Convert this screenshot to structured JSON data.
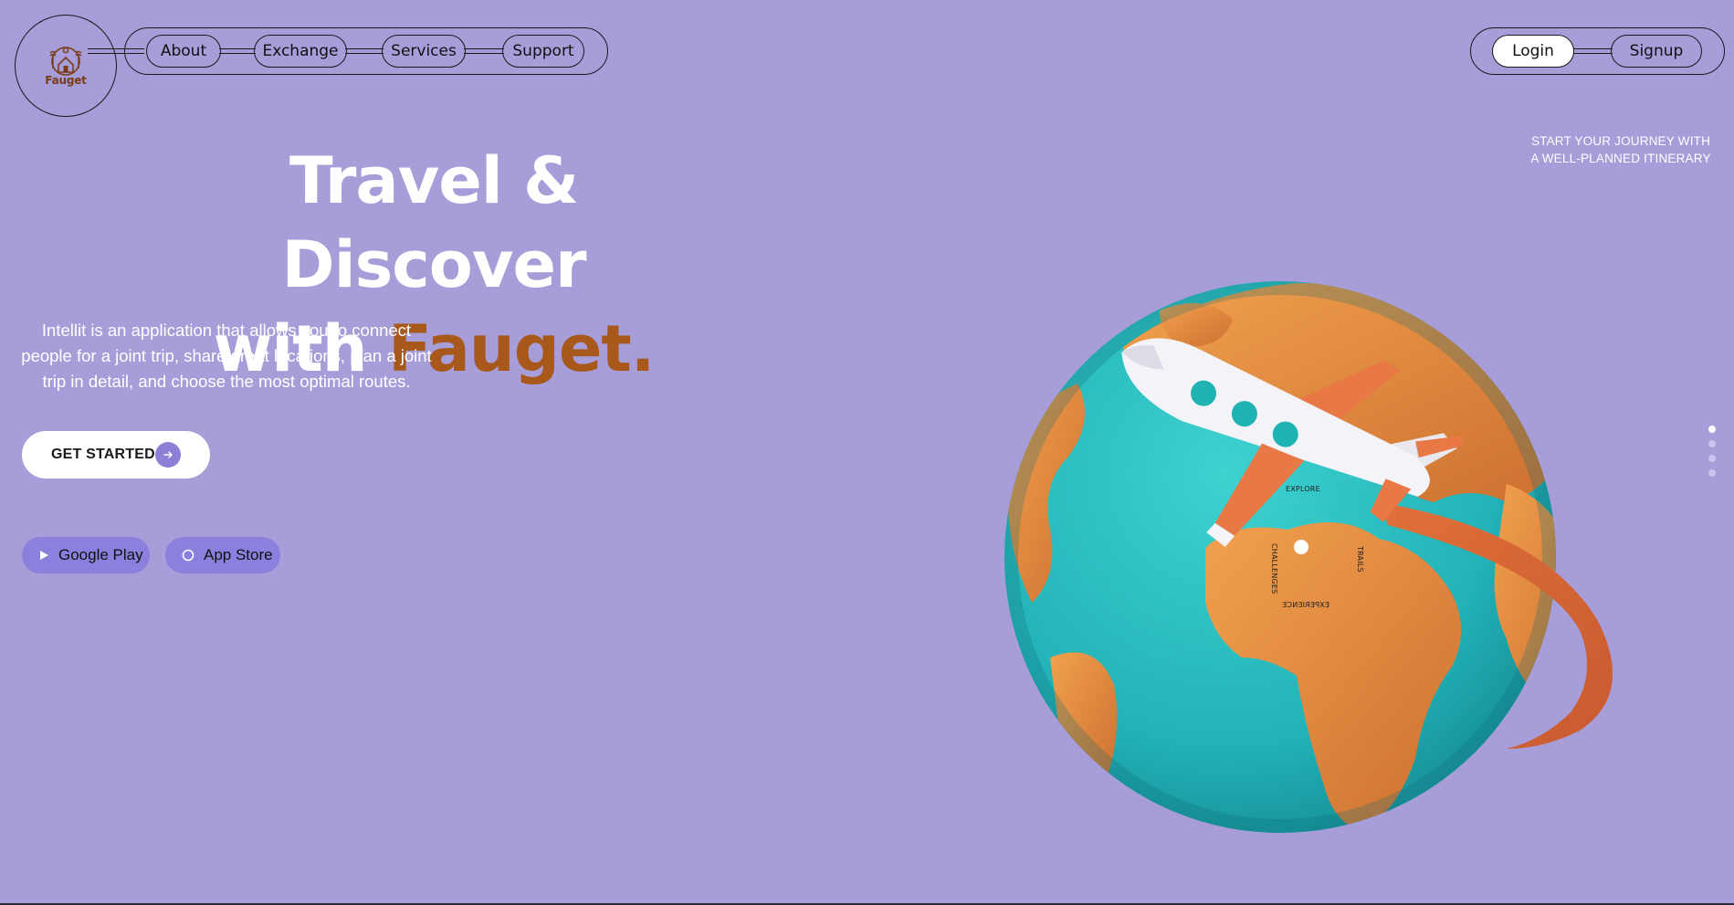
{
  "logo": {
    "text": "Fauget",
    "color": "#7a3c16"
  },
  "nav": {
    "items": [
      {
        "label": "About"
      },
      {
        "label": "Exchange"
      },
      {
        "label": "Services"
      },
      {
        "label": "Support"
      }
    ]
  },
  "auth": {
    "login_label": "Login",
    "signup_label": "Signup"
  },
  "hero": {
    "title_line1": "Travel & Discover",
    "title_line2_prefix": "with ",
    "title_brand": "Fauget.",
    "description": "Intellit is an application that allows you to connect people for a joint trip, share great locations, plan a joint trip in detail, and choose the most optimal routes.",
    "cta_label": "GET STARTED",
    "cta_icon": "arrow-right-icon"
  },
  "stores": [
    {
      "label": "Google Play",
      "icon": "play-icon"
    },
    {
      "label": "App Store",
      "icon": "circle-icon"
    }
  ],
  "tagline": {
    "line1": "START YOUR JOURNEY WITH",
    "line2": "A WELL-PLANNED ITINERARY"
  },
  "globe_labels": {
    "explore": "EXPLORE",
    "challenges": "CHALLENGES",
    "trails": "TRAILS",
    "experience": "EXPERIENCE"
  },
  "carousel": {
    "count": 4,
    "active_index": 0
  },
  "colors": {
    "background": "#a69dd9",
    "brand_accent": "#a8581a",
    "button_purple": "#8b80de",
    "globe_ocean": "#2fbfc4",
    "globe_land": "#e08a3c"
  }
}
